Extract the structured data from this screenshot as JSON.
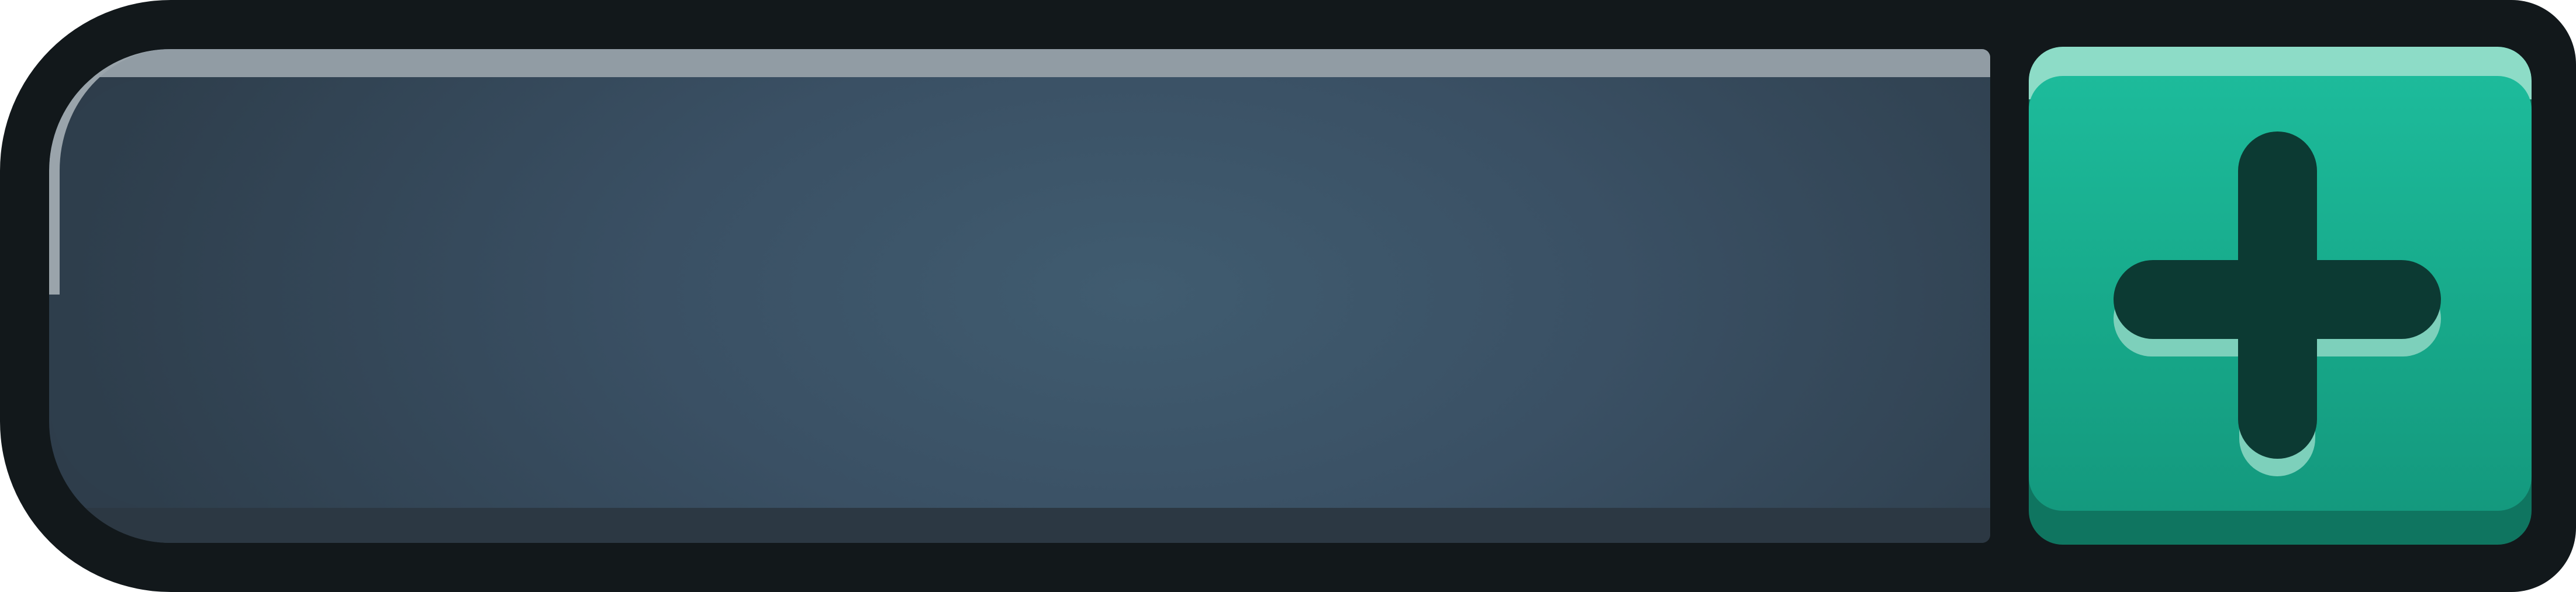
{
  "widget": {
    "input": {
      "value": "",
      "placeholder": ""
    },
    "add_button": {
      "icon": "plus-icon"
    }
  },
  "colors": {
    "frame": "#12181b",
    "field": "#3a5064",
    "button": "#1aaf8f",
    "icon": "#0c3a33"
  }
}
